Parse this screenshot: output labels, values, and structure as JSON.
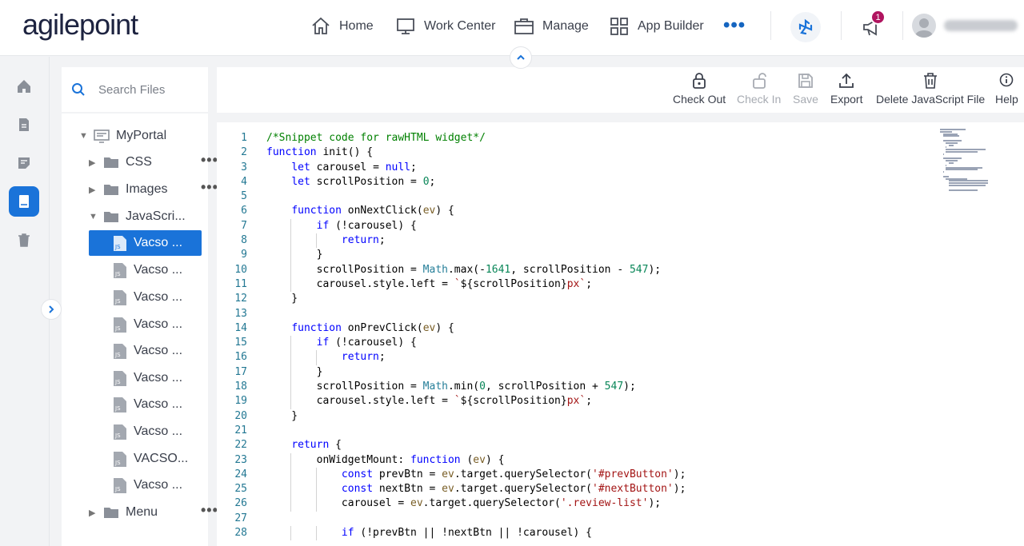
{
  "app": {
    "logo_text": "agilepoint",
    "user_name": ""
  },
  "nav": {
    "items": [
      {
        "label": "Home",
        "icon": "home-icon"
      },
      {
        "label": "Work Center",
        "icon": "monitor-icon"
      },
      {
        "label": "Manage",
        "icon": "briefcase-icon"
      },
      {
        "label": "App Builder",
        "icon": "grid-icon"
      }
    ],
    "more": "•••",
    "notification_count": "1"
  },
  "search": {
    "placeholder": "Search Files",
    "value": ""
  },
  "tree": {
    "root": "MyPortal",
    "folders": [
      "CSS",
      "Images",
      "JavaScri...",
      "Menu"
    ],
    "files": [
      "Vacso ...",
      "Vacso ...",
      "Vacso ...",
      "Vacso ...",
      "Vacso ...",
      "Vacso ...",
      "Vacso ...",
      "Vacso ...",
      "VACSO...",
      "Vacso ..."
    ],
    "more": "•••"
  },
  "toolbar": {
    "checkout": "Check Out",
    "checkin": "Check In",
    "save": "Save",
    "export": "Export",
    "delete": "Delete JavaScript File",
    "help": "Help"
  },
  "code": {
    "lines": [
      "/*Snippet code for rawHTML widget*/",
      "function init() {",
      "    let carousel = null;",
      "    let scrollPosition = 0;",
      "",
      "    function onNextClick(ev) {",
      "        if (!carousel) {",
      "            return;",
      "        }",
      "        scrollPosition = Math.max(-1641, scrollPosition - 547);",
      "        carousel.style.left = `${scrollPosition}px`;",
      "    }",
      "",
      "    function onPrevClick(ev) {",
      "        if (!carousel) {",
      "            return;",
      "        }",
      "        scrollPosition = Math.min(0, scrollPosition + 547);",
      "        carousel.style.left = `${scrollPosition}px`;",
      "    }",
      "",
      "    return {",
      "        onWidgetMount: function (ev) {",
      "            const prevBtn = ev.target.querySelector('#prevButton');",
      "            const nextBtn = ev.target.querySelector('#nextButton');",
      "            carousel = ev.target.querySelector('.review-list');",
      "",
      "            if (!prevBtn || !nextBtn || !carousel) {"
    ]
  },
  "colors": {
    "accent": "#1a73d9",
    "badge": "#b0145f",
    "keyword": "#0000ff",
    "comment": "#008000",
    "string": "#a31515",
    "number": "#098658"
  }
}
